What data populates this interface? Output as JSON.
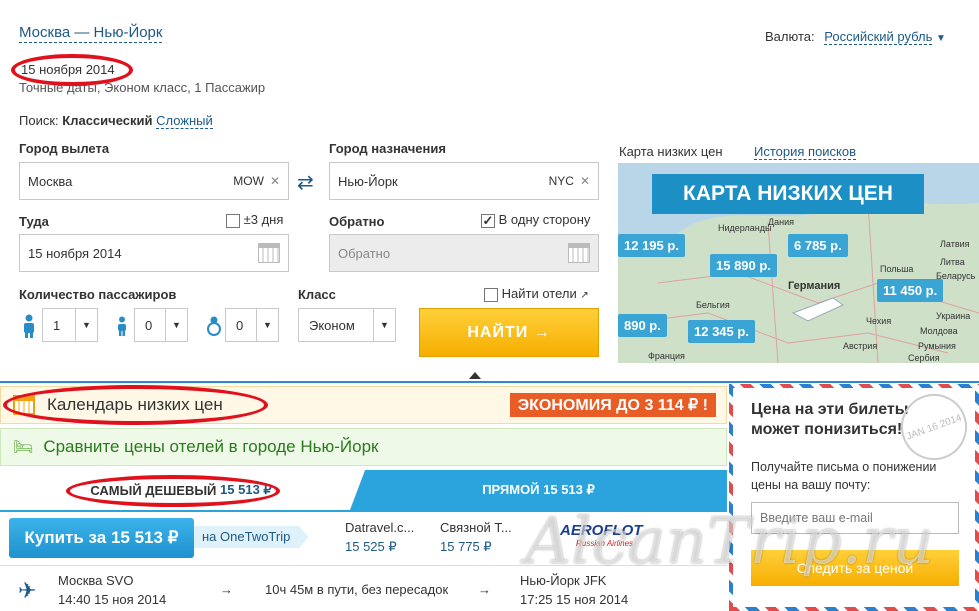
{
  "route": "Москва — Нью-Йорк",
  "date": "15 ноября 2014",
  "details": "Точные даты, Эконом класс, 1 Пассажир",
  "currency": {
    "label": "Валюта:",
    "value": "Российский рубль"
  },
  "search_mode": {
    "label": "Поиск:",
    "active": "Классический",
    "alt": "Сложный"
  },
  "from": {
    "label": "Город вылета",
    "value": "Москва",
    "code": "MOW"
  },
  "to": {
    "label": "Город назначения",
    "value": "Нью-Йорк",
    "code": "NYC"
  },
  "depart": {
    "label": "Туда",
    "flex": "±3 дня",
    "value": "15 ноября 2014"
  },
  "return": {
    "label": "Обратно",
    "oneway": "В одну сторону",
    "placeholder": "Обратно"
  },
  "passengers": {
    "label": "Количество пассажиров",
    "adults": "1",
    "children": "0",
    "infants": "0"
  },
  "class": {
    "label": "Класс",
    "value": "Эконом"
  },
  "hotels_check": "Найти отели",
  "search_button": "НАЙТИ →",
  "map": {
    "label": "Карта низких цен",
    "history": "История поисков",
    "banner": "КАРТА НИЗКИХ ЦЕН",
    "prices": [
      "12 195 р.",
      "6 785 р.",
      "15 890 р.",
      "11 450 р.",
      "890 р.",
      "12 345 р."
    ],
    "countries": [
      "Латвия",
      "Литва",
      "Беларусь",
      "Украина",
      "Германия",
      "Польша",
      "Чехия",
      "Австрия",
      "Бельгия",
      "Нидерланды",
      "Дания",
      "Франция",
      "Молдова",
      "Румыния",
      "Сербия"
    ]
  },
  "lowcal": {
    "title": "Календарь низких цен",
    "savings": "ЭКОНОМИЯ ДО 3 114 ₽ !"
  },
  "hotelcmp": {
    "title": "Сравните цены отелей в городе Нью-Йорк"
  },
  "tabs": {
    "cheapest_label": "САМЫЙ ДЕШЕВЫЙ",
    "cheapest_price": "15 513 ₽",
    "direct": "ПРЯМОЙ 15 513 ₽"
  },
  "offer": {
    "buy": "Купить за 15 513 ₽",
    "via": "на OneTwoTrip",
    "alts": [
      {
        "name": "Datravel.c...",
        "price": "15 525 ₽"
      },
      {
        "name": "Связной Т...",
        "price": "15 775 ₽"
      }
    ],
    "airline": "AEROFLOT",
    "airline_sub": "Russian Airlines"
  },
  "flight": {
    "from_city": "Москва SVO",
    "from_time": "14:40 15 ноя 2014",
    "duration": "10ч 45м в пути, без пересадок",
    "to_city": "Нью-Йорк JFK",
    "to_time": "17:25 15 ноя 2014"
  },
  "subscribe": {
    "title": "Цена на эти билеты может понизиться!",
    "text": "Получайте письма о понижении цены на вашу почту:",
    "placeholder": "Введите ваш e-mail",
    "button": "Следить за ценой",
    "stamp": "JAN 16 2014"
  },
  "watermark": "AlcanTrip.ru"
}
